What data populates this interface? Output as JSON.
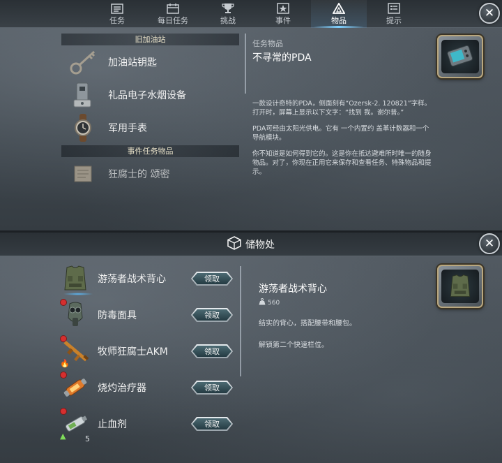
{
  "nav": {
    "tabs": [
      {
        "label": "任务",
        "icon": "list-icon",
        "active": false
      },
      {
        "label": "每日任务",
        "icon": "calendar-icon",
        "active": false
      },
      {
        "label": "挑战",
        "icon": "trophy-icon",
        "active": false
      },
      {
        "label": "事件",
        "icon": "event-star-icon",
        "active": false
      },
      {
        "label": "物品",
        "icon": "triangle-icon",
        "active": true
      },
      {
        "label": "提示",
        "icon": "hint-list-icon",
        "active": false
      }
    ],
    "close_icon": "close-icon"
  },
  "items_panel": {
    "sections": [
      {
        "header": "旧加油站",
        "items": [
          {
            "name": "加油站钥匙",
            "icon": "key-icon"
          },
          {
            "name": "礼品电子水烟设备",
            "icon": "vape-device-icon"
          },
          {
            "name": "军用手表",
            "icon": "watch-icon"
          }
        ]
      },
      {
        "header": "事件任务物品",
        "items": [
          {
            "name": "狂腐士的 颂密",
            "icon": "scroll-icon"
          }
        ]
      }
    ],
    "detail": {
      "category": "任务物品",
      "title": "不寻常的PDA",
      "paragraphs": [
        "一款设计奇特的PDA，侧面刻有“Ozersk-2. 120821”字样。打开时，屏幕上显示以下文字：“找到 我。谢尔普。”",
        "PDA可经由太阳光供电。它有 一个内置约 盖革计数器和一个导航模块。",
        "你不知道是如何得到它的。这是你在抵达避难所时唯一的随身物品。对了，你现在正用它来保存和查看任务、特殊物品和提示。"
      ],
      "portrait_icon": "pda-device-icon"
    }
  },
  "storage_panel": {
    "title": "储物处",
    "title_icon": "storage-box-icon",
    "claim_label": "领取",
    "items": [
      {
        "name": "游荡者战术背心",
        "icon": "tactical-vest-icon",
        "new": false,
        "selected": true,
        "upgrade": false,
        "count": ""
      },
      {
        "name": "防毒面具",
        "icon": "gas-mask-icon",
        "new": true,
        "selected": false,
        "upgrade": false,
        "count": ""
      },
      {
        "name": "牧师狂腐士AKM",
        "icon": "rifle-icon",
        "new": true,
        "selected": false,
        "upgrade": true,
        "count": ""
      },
      {
        "name": "烧灼治疗器",
        "icon": "cauterizer-icon",
        "new": true,
        "selected": false,
        "upgrade": false,
        "count": ""
      },
      {
        "name": "止血剂",
        "icon": "hemostatic-icon",
        "new": true,
        "selected": false,
        "upgrade": true,
        "count": "5"
      }
    ],
    "detail": {
      "title": "游荡者战术背心",
      "weight": "560",
      "weight_icon": "weight-icon",
      "paragraphs": [
        "结实的背心，搭配腰带和腰包。",
        "解锁第二个快速栏位。"
      ],
      "portrait_icon": "tactical-vest-icon"
    }
  }
}
